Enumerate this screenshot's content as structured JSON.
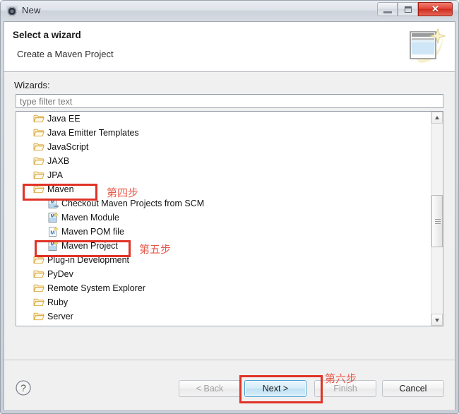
{
  "window": {
    "title": "New",
    "icon": "eclipse-gear-icon",
    "controls": {
      "minimize": "minimize-icon",
      "maximize": "maximize-icon",
      "close": "✕"
    }
  },
  "banner": {
    "title": "Select a wizard",
    "subtitle": "Create a Maven Project",
    "icon": "wizard-sparkle-icon"
  },
  "form": {
    "wizards_label": "Wizards:",
    "filter": {
      "value": "",
      "placeholder": "type filter text"
    }
  },
  "tree": {
    "items": [
      {
        "label": "Java EE",
        "level": 1,
        "icon": "folder-icon"
      },
      {
        "label": "Java Emitter Templates",
        "level": 1,
        "icon": "folder-icon"
      },
      {
        "label": "JavaScript",
        "level": 1,
        "icon": "folder-icon"
      },
      {
        "label": "JAXB",
        "level": 1,
        "icon": "folder-icon"
      },
      {
        "label": "JPA",
        "level": 1,
        "icon": "folder-icon"
      },
      {
        "label": "Maven",
        "level": 1,
        "icon": "folder-icon"
      },
      {
        "label": "Checkout Maven Projects from SCM",
        "level": 2,
        "icon": "maven-scm-icon"
      },
      {
        "label": "Maven Module",
        "level": 2,
        "icon": "maven-module-icon"
      },
      {
        "label": "Maven POM file",
        "level": 2,
        "icon": "maven-pom-icon"
      },
      {
        "label": "Maven Project",
        "level": 2,
        "icon": "maven-project-icon"
      },
      {
        "label": "Plug-in Development",
        "level": 1,
        "icon": "folder-icon"
      },
      {
        "label": "PyDev",
        "level": 1,
        "icon": "folder-icon"
      },
      {
        "label": "Remote System Explorer",
        "level": 1,
        "icon": "folder-icon"
      },
      {
        "label": "Ruby",
        "level": 1,
        "icon": "folder-icon"
      },
      {
        "label": "Server",
        "level": 1,
        "icon": "folder-icon"
      }
    ]
  },
  "buttons": {
    "help": "?",
    "back": "< Back",
    "next": "Next >",
    "finish": "Finish",
    "cancel": "Cancel"
  },
  "annotations": {
    "color": "#e03226",
    "step4": "第四步",
    "step5": "第五步",
    "step6": "第六步"
  }
}
